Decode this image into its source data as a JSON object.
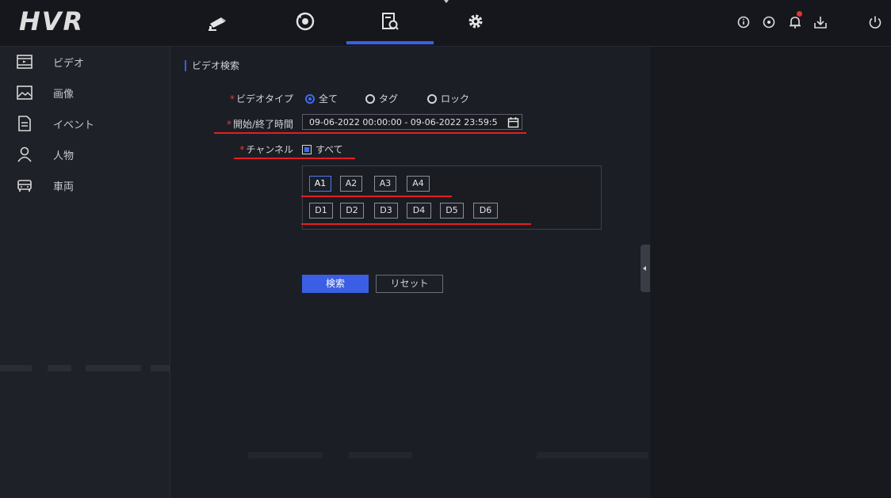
{
  "app": {
    "logo": "HVR"
  },
  "top_nav": {
    "tabs": [
      {
        "icon": "camera-icon",
        "active": false
      },
      {
        "icon": "playback-icon",
        "active": false
      },
      {
        "icon": "search-file-icon",
        "active": true
      },
      {
        "icon": "settings-gear-icon",
        "active": false
      }
    ],
    "system_icons": [
      "info-icon",
      "status-icon",
      "alarm-icon",
      "export-icon",
      "power-icon"
    ],
    "colors": {
      "accent": "#3a5fe5",
      "alarm_dot": "#e5352b"
    }
  },
  "sidebar": {
    "items": [
      {
        "label": "ビデオ",
        "icon": "video-icon"
      },
      {
        "label": "画像",
        "icon": "image-icon"
      },
      {
        "label": "イベント",
        "icon": "event-icon"
      },
      {
        "label": "人物",
        "icon": "person-icon"
      },
      {
        "label": "車両",
        "icon": "vehicle-icon"
      }
    ]
  },
  "search": {
    "section_title": "ビデオ検索",
    "required_mark": "*",
    "video_type": {
      "label": "ビデオタイプ",
      "options": [
        "全て",
        "タグ",
        "ロック"
      ],
      "selected": "全て"
    },
    "time_range": {
      "label": "開始/終了時間",
      "value": "09-06-2022 00:00:00 - 09-06-2022 23:59:5"
    },
    "channel": {
      "label": "チャンネル",
      "all_label": "すべて",
      "analog": [
        "A1",
        "A2",
        "A3",
        "A4"
      ],
      "digital": [
        "D1",
        "D2",
        "D3",
        "D4",
        "D5",
        "D6"
      ]
    },
    "buttons": {
      "search": "検索",
      "reset": "リセット"
    }
  }
}
